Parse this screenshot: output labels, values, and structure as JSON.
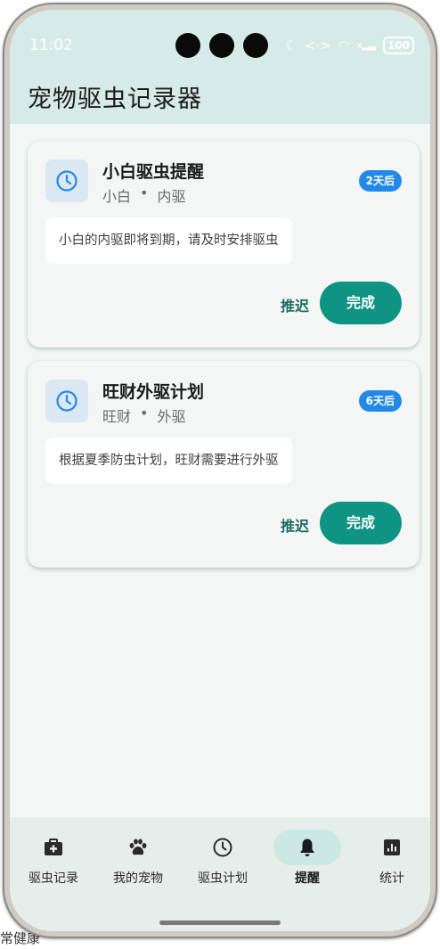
{
  "behind_text": "常健康",
  "status": {
    "time": "11:02",
    "battery": "100",
    "signal_badge": "x"
  },
  "app": {
    "title": "宠物驱虫记录器"
  },
  "reminders": [
    {
      "title": "小白驱虫提醒",
      "pet": "小白",
      "separator": "•",
      "type": "内驱",
      "badge": "2天后",
      "message": "小白的内驱即将到期，请及时安排驱虫",
      "postpone_label": "推迟",
      "done_label": "完成"
    },
    {
      "title": "旺财外驱计划",
      "pet": "旺财",
      "separator": "•",
      "type": "外驱",
      "badge": "6天后",
      "message": "根据夏季防虫计划，旺财需要进行外驱",
      "postpone_label": "推迟",
      "done_label": "完成"
    }
  ],
  "nav": [
    {
      "label": "驱虫记录",
      "icon": "medical-kit-icon"
    },
    {
      "label": "我的宠物",
      "icon": "paw-icon"
    },
    {
      "label": "驱虫计划",
      "icon": "clock-icon"
    },
    {
      "label": "提醒",
      "icon": "bell-icon",
      "active": true
    },
    {
      "label": "统计",
      "icon": "bar-chart-icon"
    }
  ],
  "colors": {
    "appbar": "#d6ebe7",
    "background": "#f1f7f5",
    "primary": "#0f9382",
    "badge": "#2389e8",
    "icon_blue": "#2389e8"
  }
}
